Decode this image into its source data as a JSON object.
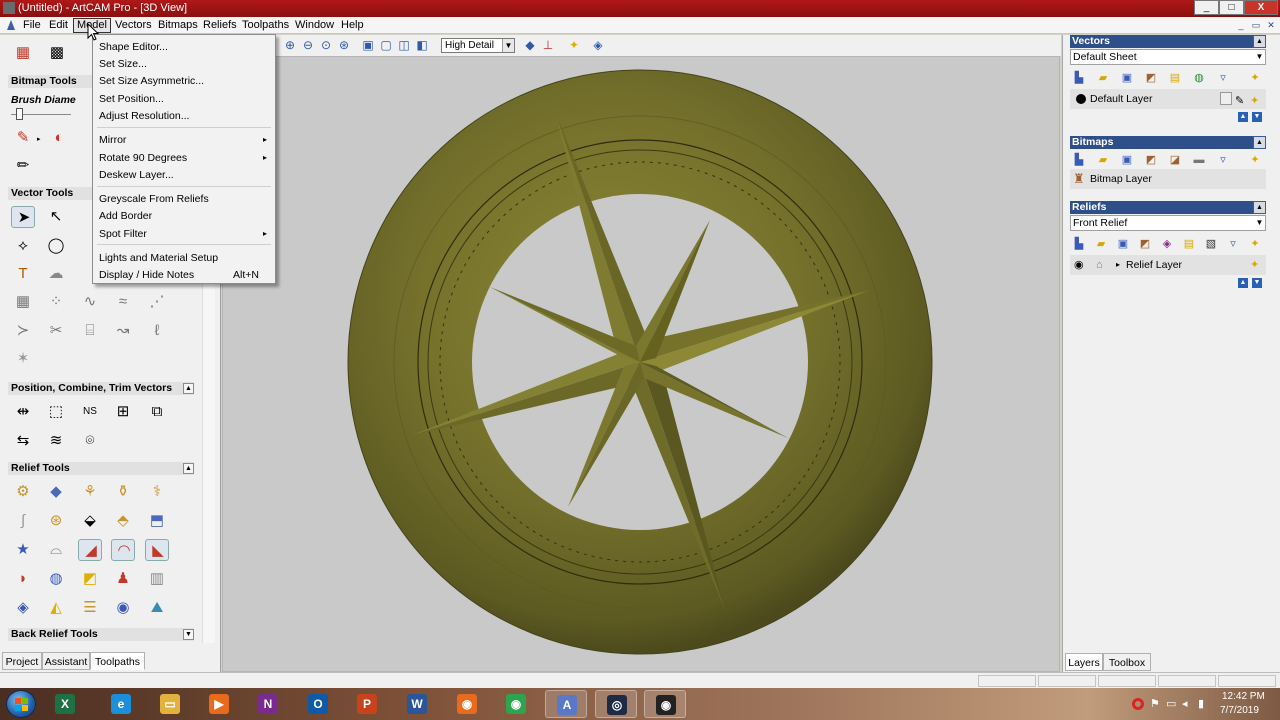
{
  "window": {
    "title": "(Untitled) - ArtCAM Pro - [3D View]",
    "min_label": "_",
    "max_label": "□",
    "close_label": "X"
  },
  "menubar": {
    "items": [
      "File",
      "Edit",
      "Model",
      "Vectors",
      "Bitmaps",
      "Reliefs",
      "Toolpaths",
      "Window",
      "Help"
    ],
    "active": "Model"
  },
  "model_menu": {
    "items": [
      {
        "label": "Shape Editor...",
        "submenu": false,
        "shortcut": ""
      },
      {
        "label": "Set Size...",
        "submenu": false,
        "shortcut": ""
      },
      {
        "label": "Set Size Asymmetric...",
        "submenu": false,
        "shortcut": ""
      },
      {
        "label": "Set Position...",
        "submenu": false,
        "shortcut": ""
      },
      {
        "label": "Adjust Resolution...",
        "submenu": false,
        "shortcut": ""
      },
      {
        "label": "Mirror",
        "submenu": true,
        "shortcut": ""
      },
      {
        "label": "Rotate 90 Degrees",
        "submenu": true,
        "shortcut": ""
      },
      {
        "label": "Deskew Layer...",
        "submenu": false,
        "shortcut": ""
      },
      {
        "label": "Greyscale From Reliefs",
        "submenu": false,
        "shortcut": ""
      },
      {
        "label": "Add Border",
        "submenu": false,
        "shortcut": ""
      },
      {
        "label": "Spot Filter",
        "submenu": true,
        "shortcut": ""
      },
      {
        "label": "Lights and Material Setup",
        "submenu": false,
        "shortcut": ""
      },
      {
        "label": "Display / Hide Notes",
        "submenu": false,
        "shortcut": "Alt+N"
      }
    ]
  },
  "toolbar": {
    "render_quality": "High Detail"
  },
  "left_panel": {
    "bitmap_tools": "Bitmap Tools",
    "brush_diameter": "Brush Diame",
    "vector_tools": "Vector Tools",
    "position_tools": "Position, Combine, Trim Vectors",
    "relief_tools": "Relief Tools",
    "back_relief_tools": "Back Relief Tools",
    "tabs": [
      "Project",
      "Assistant",
      "Toolpaths"
    ],
    "active_tab": "Toolpaths"
  },
  "right_panel": {
    "vectors": {
      "header": "Vectors",
      "sheet": "Default Sheet",
      "layer": "Default Layer"
    },
    "bitmaps": {
      "header": "Bitmaps",
      "layer": "Bitmap Layer"
    },
    "reliefs": {
      "header": "Reliefs",
      "view": "Front Relief",
      "layer": "Relief Layer"
    },
    "tabs": [
      "Layers",
      "Toolbox"
    ],
    "active_tab": "Layers"
  },
  "taskbar": {
    "apps": [
      {
        "name": "excel",
        "glyph": "X",
        "color": "#1e7145"
      },
      {
        "name": "internet-explorer",
        "glyph": "e",
        "color": "#1b8fd9"
      },
      {
        "name": "file-explorer",
        "glyph": "▭",
        "color": "#e3b23c"
      },
      {
        "name": "media-player",
        "glyph": "▶",
        "color": "#e86a1c"
      },
      {
        "name": "onenote",
        "glyph": "N",
        "color": "#7a2b8f"
      },
      {
        "name": "outlook",
        "glyph": "O",
        "color": "#0f5aa8"
      },
      {
        "name": "powerpoint",
        "glyph": "P",
        "color": "#c8421c"
      },
      {
        "name": "word",
        "glyph": "W",
        "color": "#2a5699"
      },
      {
        "name": "firefox",
        "glyph": "◉",
        "color": "#e86a1c"
      },
      {
        "name": "chrome",
        "glyph": "◉",
        "color": "#2da44e"
      },
      {
        "name": "artcam",
        "glyph": "A",
        "color": "#5a78c8"
      },
      {
        "name": "media-app",
        "glyph": "◎",
        "color": "#1d2b45"
      },
      {
        "name": "screen-recorder",
        "glyph": "◉",
        "color": "#222222"
      }
    ],
    "clock_time": "12:42 PM",
    "clock_date": "7/7/2019"
  },
  "model_color": "#6e6b28"
}
